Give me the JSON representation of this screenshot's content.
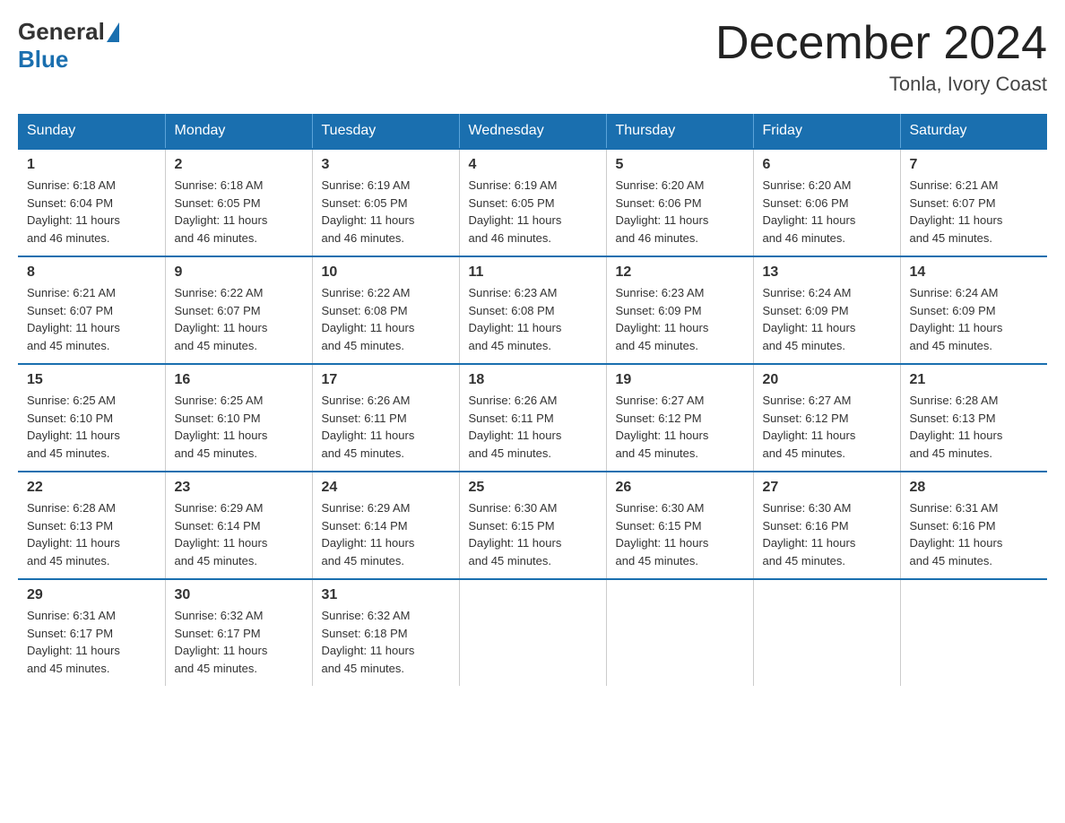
{
  "logo": {
    "general": "General",
    "blue": "Blue"
  },
  "header": {
    "title": "December 2024",
    "location": "Tonla, Ivory Coast"
  },
  "weekdays": [
    "Sunday",
    "Monday",
    "Tuesday",
    "Wednesday",
    "Thursday",
    "Friday",
    "Saturday"
  ],
  "weeks": [
    [
      {
        "day": "1",
        "sunrise": "6:18 AM",
        "sunset": "6:04 PM",
        "daylight": "11 hours and 46 minutes."
      },
      {
        "day": "2",
        "sunrise": "6:18 AM",
        "sunset": "6:05 PM",
        "daylight": "11 hours and 46 minutes."
      },
      {
        "day": "3",
        "sunrise": "6:19 AM",
        "sunset": "6:05 PM",
        "daylight": "11 hours and 46 minutes."
      },
      {
        "day": "4",
        "sunrise": "6:19 AM",
        "sunset": "6:05 PM",
        "daylight": "11 hours and 46 minutes."
      },
      {
        "day": "5",
        "sunrise": "6:20 AM",
        "sunset": "6:06 PM",
        "daylight": "11 hours and 46 minutes."
      },
      {
        "day": "6",
        "sunrise": "6:20 AM",
        "sunset": "6:06 PM",
        "daylight": "11 hours and 46 minutes."
      },
      {
        "day": "7",
        "sunrise": "6:21 AM",
        "sunset": "6:07 PM",
        "daylight": "11 hours and 45 minutes."
      }
    ],
    [
      {
        "day": "8",
        "sunrise": "6:21 AM",
        "sunset": "6:07 PM",
        "daylight": "11 hours and 45 minutes."
      },
      {
        "day": "9",
        "sunrise": "6:22 AM",
        "sunset": "6:07 PM",
        "daylight": "11 hours and 45 minutes."
      },
      {
        "day": "10",
        "sunrise": "6:22 AM",
        "sunset": "6:08 PM",
        "daylight": "11 hours and 45 minutes."
      },
      {
        "day": "11",
        "sunrise": "6:23 AM",
        "sunset": "6:08 PM",
        "daylight": "11 hours and 45 minutes."
      },
      {
        "day": "12",
        "sunrise": "6:23 AM",
        "sunset": "6:09 PM",
        "daylight": "11 hours and 45 minutes."
      },
      {
        "day": "13",
        "sunrise": "6:24 AM",
        "sunset": "6:09 PM",
        "daylight": "11 hours and 45 minutes."
      },
      {
        "day": "14",
        "sunrise": "6:24 AM",
        "sunset": "6:09 PM",
        "daylight": "11 hours and 45 minutes."
      }
    ],
    [
      {
        "day": "15",
        "sunrise": "6:25 AM",
        "sunset": "6:10 PM",
        "daylight": "11 hours and 45 minutes."
      },
      {
        "day": "16",
        "sunrise": "6:25 AM",
        "sunset": "6:10 PM",
        "daylight": "11 hours and 45 minutes."
      },
      {
        "day": "17",
        "sunrise": "6:26 AM",
        "sunset": "6:11 PM",
        "daylight": "11 hours and 45 minutes."
      },
      {
        "day": "18",
        "sunrise": "6:26 AM",
        "sunset": "6:11 PM",
        "daylight": "11 hours and 45 minutes."
      },
      {
        "day": "19",
        "sunrise": "6:27 AM",
        "sunset": "6:12 PM",
        "daylight": "11 hours and 45 minutes."
      },
      {
        "day": "20",
        "sunrise": "6:27 AM",
        "sunset": "6:12 PM",
        "daylight": "11 hours and 45 minutes."
      },
      {
        "day": "21",
        "sunrise": "6:28 AM",
        "sunset": "6:13 PM",
        "daylight": "11 hours and 45 minutes."
      }
    ],
    [
      {
        "day": "22",
        "sunrise": "6:28 AM",
        "sunset": "6:13 PM",
        "daylight": "11 hours and 45 minutes."
      },
      {
        "day": "23",
        "sunrise": "6:29 AM",
        "sunset": "6:14 PM",
        "daylight": "11 hours and 45 minutes."
      },
      {
        "day": "24",
        "sunrise": "6:29 AM",
        "sunset": "6:14 PM",
        "daylight": "11 hours and 45 minutes."
      },
      {
        "day": "25",
        "sunrise": "6:30 AM",
        "sunset": "6:15 PM",
        "daylight": "11 hours and 45 minutes."
      },
      {
        "day": "26",
        "sunrise": "6:30 AM",
        "sunset": "6:15 PM",
        "daylight": "11 hours and 45 minutes."
      },
      {
        "day": "27",
        "sunrise": "6:30 AM",
        "sunset": "6:16 PM",
        "daylight": "11 hours and 45 minutes."
      },
      {
        "day": "28",
        "sunrise": "6:31 AM",
        "sunset": "6:16 PM",
        "daylight": "11 hours and 45 minutes."
      }
    ],
    [
      {
        "day": "29",
        "sunrise": "6:31 AM",
        "sunset": "6:17 PM",
        "daylight": "11 hours and 45 minutes."
      },
      {
        "day": "30",
        "sunrise": "6:32 AM",
        "sunset": "6:17 PM",
        "daylight": "11 hours and 45 minutes."
      },
      {
        "day": "31",
        "sunrise": "6:32 AM",
        "sunset": "6:18 PM",
        "daylight": "11 hours and 45 minutes."
      },
      null,
      null,
      null,
      null
    ]
  ],
  "labels": {
    "sunrise": "Sunrise:",
    "sunset": "Sunset:",
    "daylight": "Daylight:"
  }
}
